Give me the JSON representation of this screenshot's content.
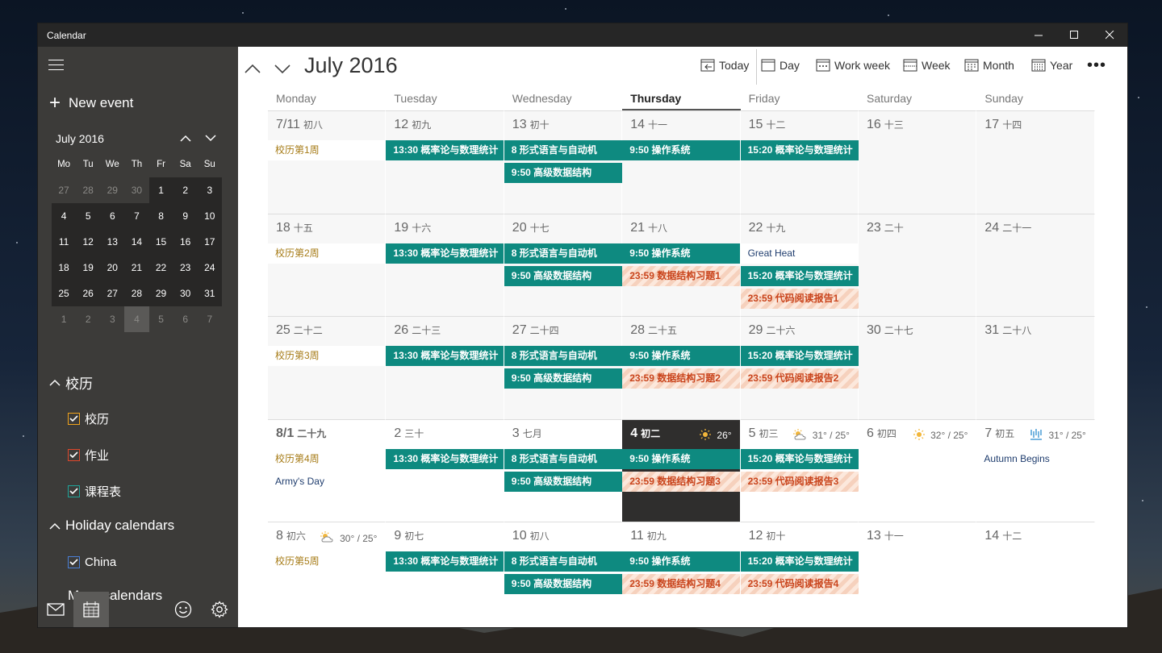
{
  "window": {
    "title": "Calendar",
    "minimize_icon": "minimize-icon",
    "maximize_icon": "maximize-icon",
    "close_icon": "close-icon"
  },
  "sidebar": {
    "new_event_label": "New event",
    "mini_calendar": {
      "title": "July 2016",
      "weekday_headers": [
        "Mo",
        "Tu",
        "We",
        "Th",
        "Fr",
        "Sa",
        "Su"
      ],
      "weeks": [
        [
          "27",
          "28",
          "29",
          "30",
          "1",
          "2",
          "3"
        ],
        [
          "4",
          "5",
          "6",
          "7",
          "8",
          "9",
          "10"
        ],
        [
          "11",
          "12",
          "13",
          "14",
          "15",
          "16",
          "17"
        ],
        [
          "18",
          "19",
          "20",
          "21",
          "22",
          "23",
          "24"
        ],
        [
          "25",
          "26",
          "27",
          "28",
          "29",
          "30",
          "31"
        ],
        [
          "1",
          "2",
          "3",
          "4",
          "5",
          "6",
          "7"
        ]
      ],
      "today_label": "4"
    },
    "groups": [
      {
        "label": "校历",
        "calendars": [
          {
            "label": "校历",
            "color": "#f0a31b",
            "checked": true
          },
          {
            "label": "作业",
            "color": "#e0472b",
            "checked": true
          },
          {
            "label": "课程表",
            "color": "#1fa59a",
            "checked": true
          }
        ]
      },
      {
        "label": "Holiday calendars",
        "calendars": [
          {
            "label": "China",
            "color": "#4a7fd6",
            "checked": true
          }
        ]
      }
    ],
    "more_calendars_label": "More calendars"
  },
  "toolbar": {
    "title": "July 2016",
    "views": [
      {
        "label": "Today",
        "icon": "today-icon"
      },
      {
        "label": "Day",
        "icon": "day-icon"
      },
      {
        "label": "Work week",
        "icon": "work-week-icon"
      },
      {
        "label": "Week",
        "icon": "week-icon"
      },
      {
        "label": "Month",
        "icon": "month-icon"
      },
      {
        "label": "Year",
        "icon": "year-icon"
      }
    ],
    "more_label": "•••"
  },
  "weekdays": [
    "Monday",
    "Tuesday",
    "Wednesday",
    "Thursday",
    "Friday",
    "Saturday",
    "Sunday"
  ],
  "weeks": [
    {
      "days": [
        {
          "num": "7/11",
          "lunar": "初八",
          "events": [
            {
              "text": "校历第1周",
              "kind": "note"
            }
          ]
        },
        {
          "num": "12",
          "lunar": "初九",
          "events": [
            {
              "text": "13:30 概率论与数理统计",
              "kind": "teal"
            }
          ]
        },
        {
          "num": "13",
          "lunar": "初十",
          "events": [
            {
              "text": "8 形式语言与自动机",
              "kind": "teal"
            },
            {
              "text": "9:50 高级数据结构",
              "kind": "teal"
            }
          ]
        },
        {
          "num": "14",
          "lunar": "十一",
          "events": [
            {
              "text": "9:50 操作系统",
              "kind": "teal"
            }
          ]
        },
        {
          "num": "15",
          "lunar": "十二",
          "events": [
            {
              "text": "15:20 概率论与数理统计",
              "kind": "teal"
            }
          ]
        },
        {
          "num": "16",
          "lunar": "十三",
          "events": []
        },
        {
          "num": "17",
          "lunar": "十四",
          "events": []
        }
      ]
    },
    {
      "days": [
        {
          "num": "18",
          "lunar": "十五",
          "events": [
            {
              "text": "校历第2周",
              "kind": "note"
            }
          ]
        },
        {
          "num": "19",
          "lunar": "十六",
          "events": [
            {
              "text": "13:30 概率论与数理统计",
              "kind": "teal"
            }
          ]
        },
        {
          "num": "20",
          "lunar": "十七",
          "events": [
            {
              "text": "8 形式语言与自动机",
              "kind": "teal"
            },
            {
              "text": "9:50 高级数据结构",
              "kind": "teal"
            }
          ]
        },
        {
          "num": "21",
          "lunar": "十八",
          "events": [
            {
              "text": "9:50 操作系统",
              "kind": "teal"
            },
            {
              "text": "23:59 数据结构习题1",
              "kind": "dead"
            }
          ]
        },
        {
          "num": "22",
          "lunar": "十九",
          "events": [
            {
              "text": "Great Heat",
              "kind": "hol wbg"
            },
            {
              "text": "15:20 概率论与数理统计",
              "kind": "teal"
            },
            {
              "text": "23:59 代码阅读报告1",
              "kind": "dead"
            }
          ]
        },
        {
          "num": "23",
          "lunar": "二十",
          "events": []
        },
        {
          "num": "24",
          "lunar": "二十一",
          "events": []
        }
      ]
    },
    {
      "days": [
        {
          "num": "25",
          "lunar": "二十二",
          "events": [
            {
              "text": "校历第3周",
              "kind": "note"
            }
          ]
        },
        {
          "num": "26",
          "lunar": "二十三",
          "events": [
            {
              "text": "13:30 概率论与数理统计",
              "kind": "teal"
            }
          ]
        },
        {
          "num": "27",
          "lunar": "二十四",
          "events": [
            {
              "text": "8 形式语言与自动机",
              "kind": "teal"
            },
            {
              "text": "9:50 高级数据结构",
              "kind": "teal"
            }
          ]
        },
        {
          "num": "28",
          "lunar": "二十五",
          "events": [
            {
              "text": "9:50 操作系统",
              "kind": "teal"
            },
            {
              "text": "23:59 数据结构习题2",
              "kind": "dead"
            }
          ]
        },
        {
          "num": "29",
          "lunar": "二十六",
          "events": [
            {
              "text": "15:20 概率论与数理统计",
              "kind": "teal"
            },
            {
              "text": "23:59 代码阅读报告2",
              "kind": "dead"
            }
          ]
        },
        {
          "num": "30",
          "lunar": "二十七",
          "events": []
        },
        {
          "num": "31",
          "lunar": "二十八",
          "events": []
        }
      ]
    },
    {
      "days": [
        {
          "num": "8/1",
          "lunar": "二十九",
          "events": [
            {
              "text": "校历第4周",
              "kind": "note"
            },
            {
              "text": "Army's Day",
              "kind": "hol"
            }
          ]
        },
        {
          "num": "2",
          "lunar": "三十",
          "events": [
            {
              "text": "13:30 概率论与数理统计",
              "kind": "teal"
            }
          ]
        },
        {
          "num": "3",
          "lunar": "七月",
          "events": [
            {
              "text": "8 形式语言与自动机",
              "kind": "teal"
            },
            {
              "text": "9:50 高级数据结构",
              "kind": "teal"
            }
          ]
        },
        {
          "num": "4",
          "lunar": "初二",
          "weather": {
            "text": "26°",
            "icon": "sunny-icon"
          },
          "events": [
            {
              "text": "9:50 操作系统",
              "kind": "teal"
            },
            {
              "text": "23:59 数据结构习题3",
              "kind": "dead"
            }
          ]
        },
        {
          "num": "5",
          "lunar": "初三",
          "weather": {
            "text": "31° / 25°",
            "icon": "partly-cloudy-icon"
          },
          "events": [
            {
              "text": "15:20 概率论与数理统计",
              "kind": "teal"
            },
            {
              "text": "23:59 代码阅读报告3",
              "kind": "dead"
            }
          ]
        },
        {
          "num": "6",
          "lunar": "初四",
          "weather": {
            "text": "32° / 25°",
            "icon": "sunny-icon"
          },
          "events": []
        },
        {
          "num": "7",
          "lunar": "初五",
          "weather": {
            "text": "31° / 25°",
            "icon": "rain-icon"
          },
          "events": [
            {
              "text": "Autumn Begins",
              "kind": "hol"
            }
          ]
        }
      ]
    },
    {
      "days": [
        {
          "num": "8",
          "lunar": "初六",
          "weather": {
            "text": "30° / 25°",
            "icon": "partly-cloudy-icon"
          },
          "events": [
            {
              "text": "校历第5周",
              "kind": "note"
            }
          ]
        },
        {
          "num": "9",
          "lunar": "初七",
          "events": [
            {
              "text": "13:30 概率论与数理统计",
              "kind": "teal"
            }
          ]
        },
        {
          "num": "10",
          "lunar": "初八",
          "events": [
            {
              "text": "8 形式语言与自动机",
              "kind": "teal"
            },
            {
              "text": "9:50 高级数据结构",
              "kind": "teal"
            }
          ]
        },
        {
          "num": "11",
          "lunar": "初九",
          "events": [
            {
              "text": "9:50 操作系统",
              "kind": "teal"
            },
            {
              "text": "23:59 数据结构习题4",
              "kind": "dead"
            }
          ]
        },
        {
          "num": "12",
          "lunar": "初十",
          "events": [
            {
              "text": "15:20 概率论与数理统计",
              "kind": "teal"
            },
            {
              "text": "23:59 代码阅读报告4",
              "kind": "dead"
            }
          ]
        },
        {
          "num": "13",
          "lunar": "十一",
          "events": []
        },
        {
          "num": "14",
          "lunar": "十二",
          "events": []
        }
      ]
    }
  ],
  "bottom_bar": [
    {
      "icon": "mail-icon"
    },
    {
      "icon": "calendar-icon"
    },
    {
      "icon": "feedback-smiley-icon"
    },
    {
      "icon": "settings-gear-icon"
    }
  ]
}
